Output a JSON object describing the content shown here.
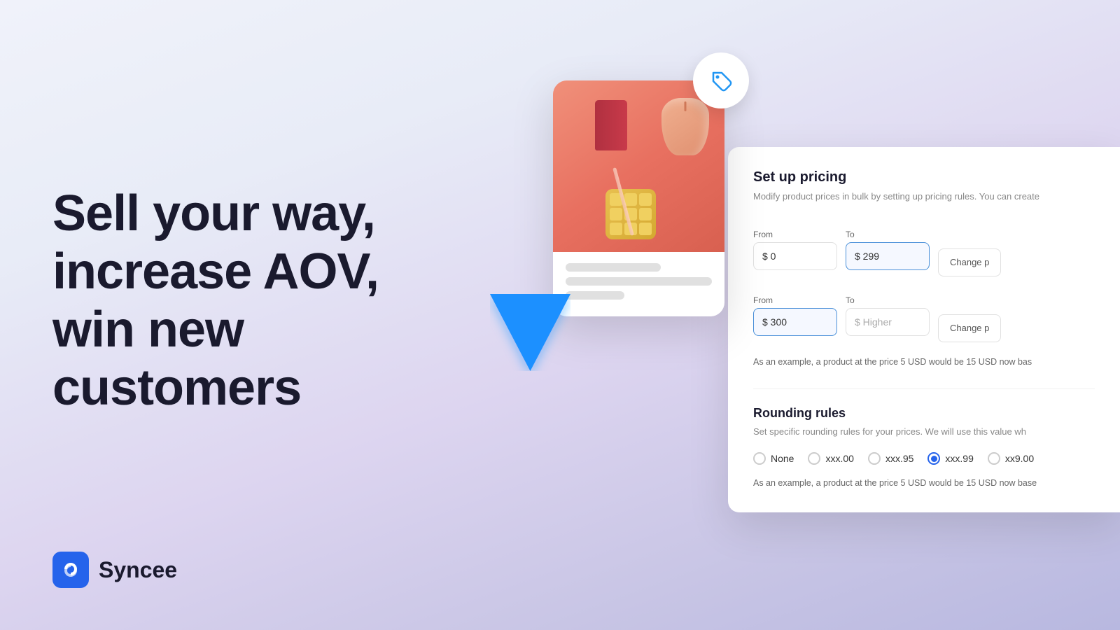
{
  "hero": {
    "line1": "Sell your way,",
    "line2": "increase AOV,",
    "line3": "win new customers"
  },
  "logo": {
    "name": "Syncee"
  },
  "pricing_panel": {
    "title": "Set up pricing",
    "subtitle": "Modify product prices in bulk by setting up pricing rules. You can create",
    "row1": {
      "from_label": "From",
      "to_label": "To",
      "from_value": "$ 0",
      "to_value": "$ 299",
      "change_button": "Change p"
    },
    "row2": {
      "from_label": "From",
      "to_label": "To",
      "from_value": "$ 300",
      "to_placeholder": "$ Higher",
      "change_button": "Change p"
    },
    "example_text": "As an example, a product at the price 5 USD would be 15 USD now bas"
  },
  "rounding": {
    "title": "Rounding rules",
    "subtitle": "Set specific rounding rules for your prices. We will use this value wh",
    "options": [
      {
        "id": "none",
        "label": "None",
        "selected": false
      },
      {
        "id": "xxx00",
        "label": "xxx.00",
        "selected": false
      },
      {
        "id": "xxx95",
        "label": "xxx.95",
        "selected": false
      },
      {
        "id": "xxx99",
        "label": "xxx.99",
        "selected": true
      },
      {
        "id": "xx900",
        "label": "xx9.00",
        "selected": false
      }
    ],
    "example_text": "As an example, a product at the price 5 USD would be 15 USD now base"
  },
  "tag_icon": "🏷",
  "product_lines": {
    "line1_width": "65%",
    "line2_width": "90%",
    "line3_width": "40%"
  }
}
